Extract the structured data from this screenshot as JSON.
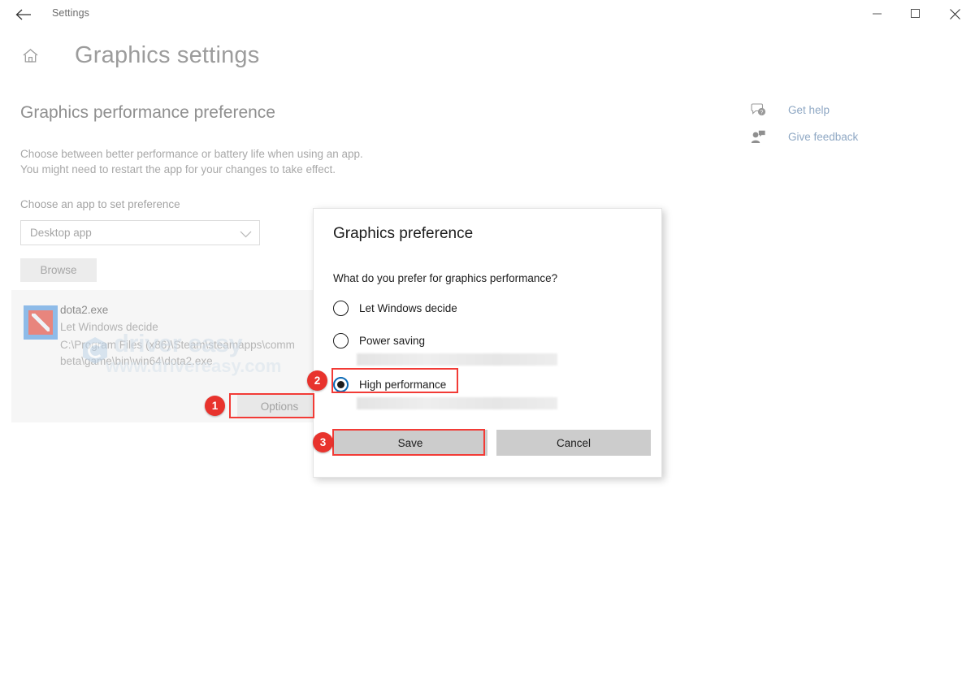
{
  "window": {
    "titlebar_label": "Settings",
    "back_icon": "back-arrow-icon",
    "minimize_label": "─",
    "maximize_label": "□",
    "close_label": "✕"
  },
  "header": {
    "home_icon": "home-icon",
    "title": "Graphics settings"
  },
  "main": {
    "section_title": "Graphics performance preference",
    "description_line1": "Choose between better performance or battery life when using an app.",
    "description_line2": "You might need to restart the app for your changes to take effect.",
    "choose_label": "Choose an app to set preference",
    "dropdown_value": "Desktop app",
    "dropdown_chevron_icon": "chevron-down-icon",
    "browse_label": "Browse"
  },
  "app_entry": {
    "icon_name": "dota2-app-icon",
    "name": "dota2.exe",
    "current_preference": "Let Windows decide",
    "path_line1": "C:\\Program Files (x86)\\Steam\\steamapps\\comm",
    "path_line2": "beta\\game\\bin\\win64\\dota2.exe",
    "options_label": "Options"
  },
  "watermark": {
    "brand": "driver easy",
    "url": "www.drivereasy.com"
  },
  "right_links": [
    {
      "label": "Get help",
      "icon": "help-bubble-icon"
    },
    {
      "label": "Give feedback",
      "icon": "feedback-person-icon"
    }
  ],
  "dialog": {
    "title": "Graphics preference",
    "question": "What do you prefer for graphics performance?",
    "options": [
      {
        "label": "Let Windows decide",
        "selected": false
      },
      {
        "label": "Power saving",
        "selected": false
      },
      {
        "label": "High performance",
        "selected": true
      }
    ],
    "save_label": "Save",
    "cancel_label": "Cancel"
  },
  "annotations": {
    "accent_color": "#e8332d",
    "badges": [
      {
        "number": "1",
        "target": "options-button"
      },
      {
        "number": "2",
        "target": "high-performance-radio"
      },
      {
        "number": "3",
        "target": "save-button"
      }
    ]
  }
}
